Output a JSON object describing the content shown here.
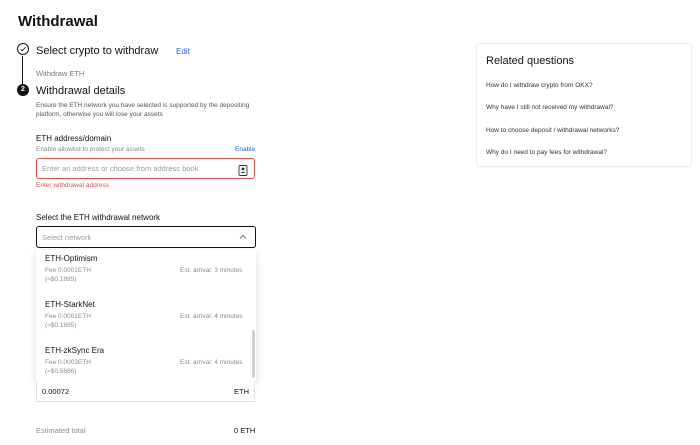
{
  "page": {
    "title": "Withdrawal"
  },
  "step1": {
    "title": "Select crypto to withdraw",
    "edit": "Edit",
    "selected": "Withdraw ETH"
  },
  "step2": {
    "number": "2",
    "title": "Withdrawal details",
    "note": "Ensure the ETH network you have selected is supported by the depositing platform, otherwise you will lose your assets"
  },
  "address": {
    "label": "ETH address/domain",
    "allowlist": "Enable allowlist to protect your assets",
    "enable": "Enable",
    "placeholder": "Enter an address or choose from address book",
    "value": "",
    "error": "Enter withdrawal address",
    "icon": "address-book-icon"
  },
  "network": {
    "label": "Select the ETH withdrawal network",
    "placeholder": "Select network",
    "options": [
      {
        "name": "ETH-Optimism",
        "fee": "Fee 0.0001ETH",
        "fee_usd": "(≈$0.1895)",
        "arrival": "Est. arrival: 3 minutes"
      },
      {
        "name": "ETH-StarkNet",
        "fee": "Fee 0.0001ETH",
        "fee_usd": "(≈$0.1895)",
        "arrival": "Est. arrival: 4 minutes"
      },
      {
        "name": "ETH-zkSync Era",
        "fee": "Fee 0.0003ETH",
        "fee_usd": "(≈$0.5686)",
        "arrival": "Est. arrival: 4 minutes"
      }
    ]
  },
  "amount": {
    "value": "0.00072",
    "unit": "ETH"
  },
  "estimated": {
    "label": "Estimated total",
    "value": "0 ETH"
  },
  "related": {
    "title": "Related questions",
    "questions": [
      "How do I withdraw crypto from OKX?",
      "Why have I still not received my withdrawal?",
      "How to choose deposit / withdrawal networks?",
      "Why do I need to pay fees for withdrawal?"
    ]
  },
  "colors": {
    "link": "#2962d9",
    "error": "#d9534f",
    "text": "#121212"
  }
}
